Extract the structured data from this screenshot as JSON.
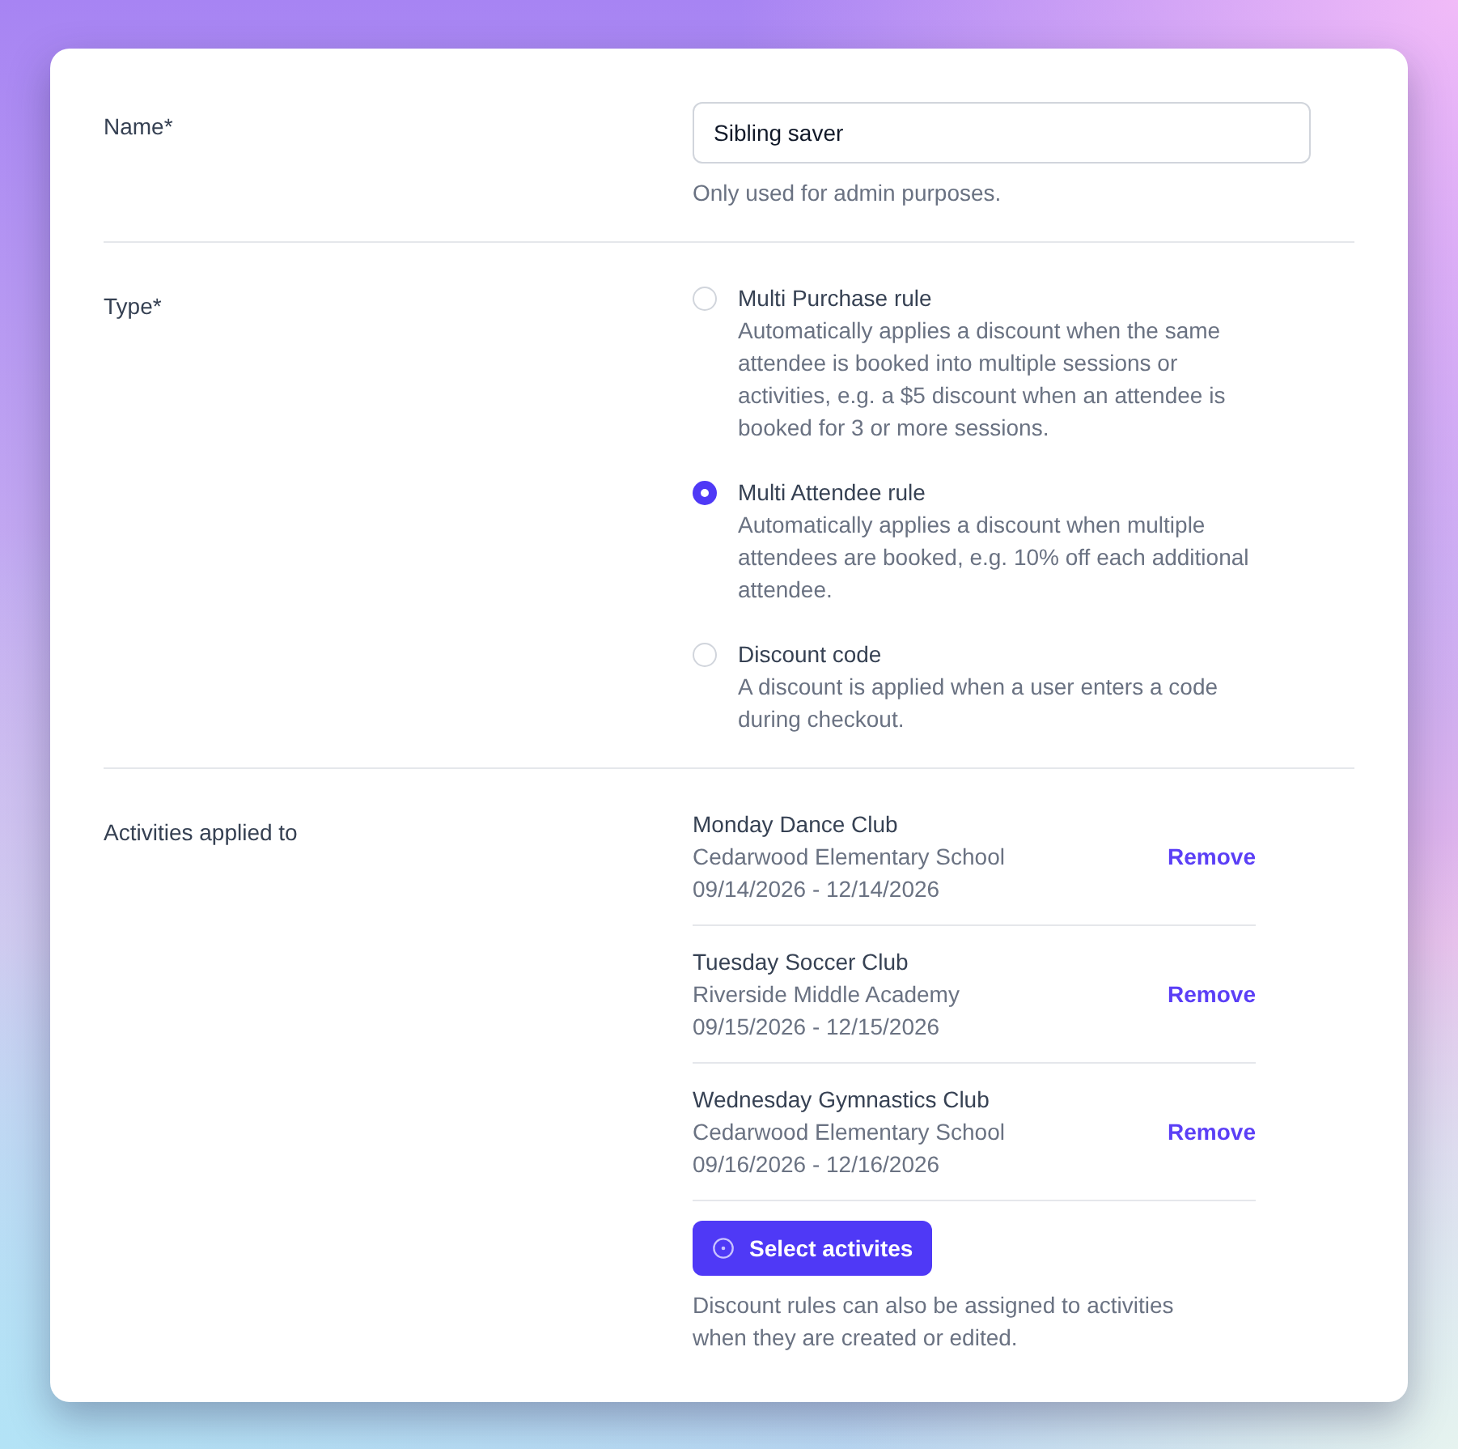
{
  "name_field": {
    "label": "Name*",
    "value": "Sibling saver",
    "help": "Only used for admin purposes."
  },
  "type_field": {
    "label": "Type*",
    "options": [
      {
        "title": "Multi Purchase rule",
        "description": "Automatically applies a discount when the same attendee is booked into multiple sessions or activities, e.g. a $5 discount when an attendee is booked for 3 or more sessions.",
        "selected": false
      },
      {
        "title": "Multi Attendee rule",
        "description": "Automatically applies a discount when multiple attendees are booked, e.g. 10% off each additional attendee.",
        "selected": true
      },
      {
        "title": "Discount code",
        "description": "A discount is applied when a user enters a code during checkout.",
        "selected": false
      }
    ]
  },
  "activities_field": {
    "label": "Activities applied to",
    "activities": [
      {
        "name": "Monday Dance Club",
        "school": "Cedarwood Elementary School",
        "dates": "09/14/2026 - 12/14/2026",
        "action": "Remove"
      },
      {
        "name": "Tuesday Soccer Club",
        "school": "Riverside Middle Academy",
        "dates": "09/15/2026 - 12/15/2026",
        "action": "Remove"
      },
      {
        "name": "Wednesday Gymnastics Club",
        "school": "Cedarwood Elementary School",
        "dates": "09/16/2026 - 12/16/2026",
        "action": "Remove"
      }
    ],
    "button": "Select activites",
    "help": "Discount rules can also be assigned to activities when they are created or edited."
  }
}
